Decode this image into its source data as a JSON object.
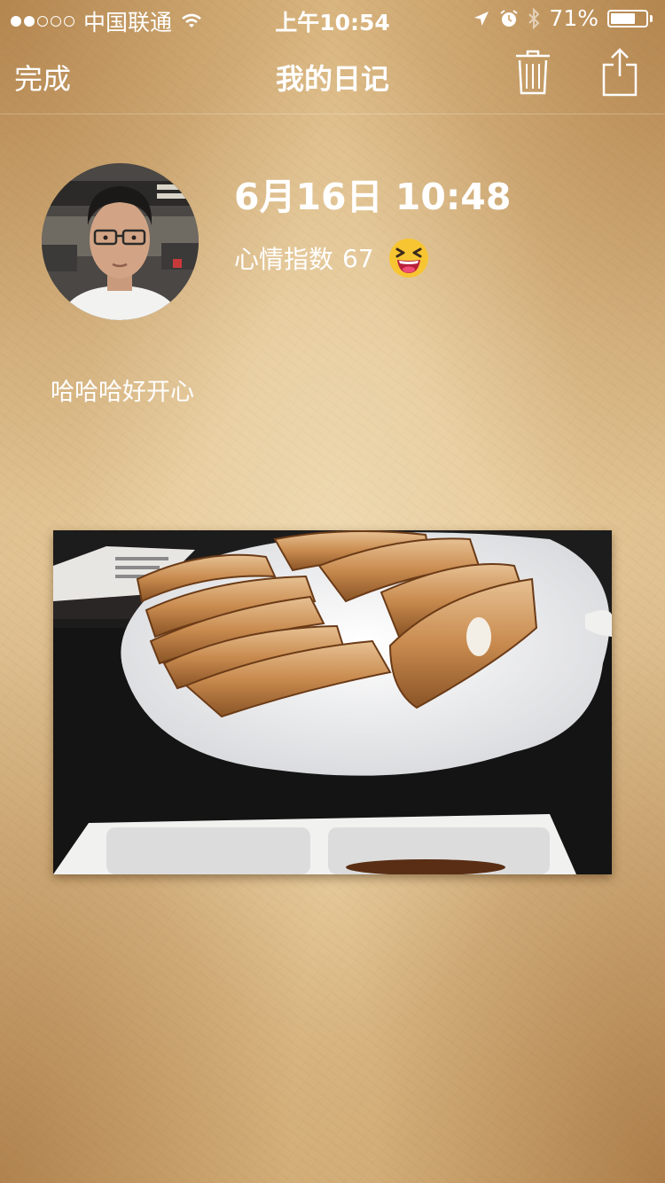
{
  "status_bar": {
    "carrier": "中国联通",
    "time": "上午10:54",
    "battery_percent": "71%",
    "battery_level": 0.71,
    "signal_bars_filled": 2,
    "signal_bars_total": 5
  },
  "nav": {
    "done_label": "完成",
    "title": "我的日记",
    "trash_icon": "trash-icon",
    "share_icon": "share-icon"
  },
  "entry": {
    "date_time": "6月16日 10:48",
    "mood_label": "心情指数",
    "mood_value": "67",
    "mood_emoji": "laughing-emoji-icon",
    "text": "哈哈哈好开心",
    "photo": "dumplings-photo"
  },
  "colors": {
    "paper": "#e4c796",
    "paper_edge": "#c8975a",
    "text": "#ffffff",
    "emoji_yellow": "#f7c531"
  }
}
